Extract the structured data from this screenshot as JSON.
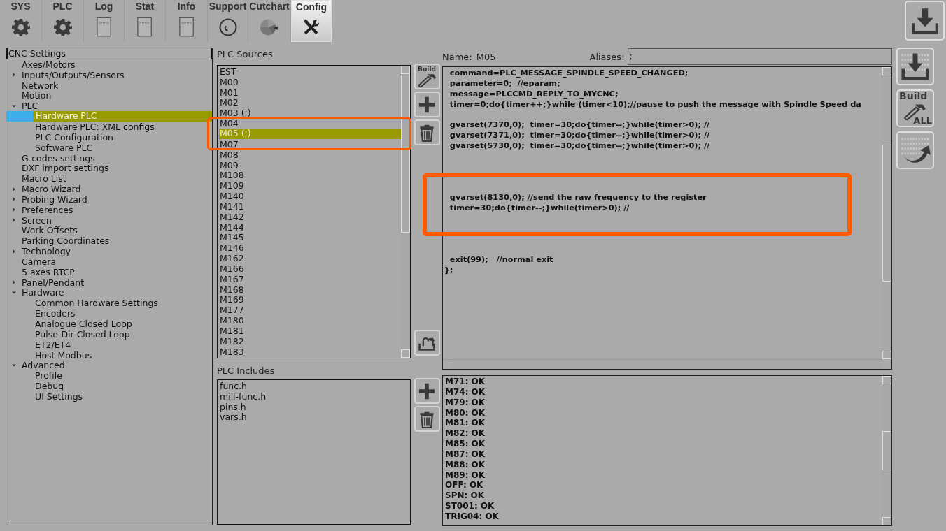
{
  "tabs": [
    {
      "label": "SYS",
      "kind": "settings",
      "selected": false
    },
    {
      "label": "PLC",
      "kind": "settings",
      "selected": false
    },
    {
      "label": "Log",
      "kind": "document",
      "selected": false
    },
    {
      "label": "Stat",
      "kind": "document",
      "selected": false
    },
    {
      "label": "Info",
      "kind": "document",
      "selected": false
    },
    {
      "label": "Support",
      "kind": "support",
      "selected": false
    },
    {
      "label": "Cutchart",
      "kind": "chart",
      "selected": false
    },
    {
      "label": "Config",
      "kind": "tools",
      "selected": true
    }
  ],
  "settings_tree": {
    "title": "CNC Settings",
    "items": [
      {
        "label": "Axes/Motors",
        "selected": false
      },
      {
        "label": "Inputs/Outputs/Sensors",
        "expanded": false,
        "selected": false
      },
      {
        "label": "Network",
        "selected": false
      },
      {
        "label": "Motion",
        "selected": false
      },
      {
        "label": "PLC",
        "expanded": true,
        "selected": false,
        "children": [
          {
            "label": "Hardware PLC",
            "selected": true
          },
          {
            "label": "Hardware PLC: XML configs",
            "selected": false
          },
          {
            "label": "PLC Configuration",
            "selected": false
          },
          {
            "label": "Software PLC",
            "selected": false
          }
        ]
      },
      {
        "label": "G-codes settings",
        "selected": false
      },
      {
        "label": "DXF import settings",
        "selected": false
      },
      {
        "label": "Macro List",
        "selected": false
      },
      {
        "label": "Macro Wizard",
        "expanded": false,
        "selected": false
      },
      {
        "label": "Probing Wizard",
        "expanded": false,
        "selected": false
      },
      {
        "label": "Preferences",
        "expanded": false,
        "selected": false
      },
      {
        "label": "Screen",
        "expanded": false,
        "selected": false
      },
      {
        "label": "Work Offsets",
        "selected": false
      },
      {
        "label": "Parking Coordinates",
        "selected": false
      },
      {
        "label": "Technology",
        "expanded": false,
        "selected": false
      },
      {
        "label": "Camera",
        "selected": false
      },
      {
        "label": "5 axes RTCP",
        "selected": false
      },
      {
        "label": "Panel/Pendant",
        "expanded": false,
        "selected": false
      },
      {
        "label": "Hardware",
        "expanded": true,
        "selected": false,
        "children": [
          {
            "label": "Common Hardware Settings",
            "selected": false
          },
          {
            "label": "Encoders",
            "selected": false
          },
          {
            "label": "Analogue Closed Loop",
            "selected": false
          },
          {
            "label": "Pulse-Dir Closed Loop",
            "selected": false
          },
          {
            "label": "ET2/ET4",
            "selected": false
          },
          {
            "label": "Host Modbus",
            "selected": false
          }
        ]
      },
      {
        "label": "Advanced",
        "expanded": true,
        "selected": false,
        "children": [
          {
            "label": "Profile",
            "selected": false
          },
          {
            "label": "Debug",
            "selected": false
          },
          {
            "label": "UI Settings",
            "selected": false
          }
        ]
      }
    ]
  },
  "plc_sources": {
    "title": "PLC Sources",
    "annotation_frame": true,
    "items": [
      {
        "label": "EST",
        "selected": false
      },
      {
        "label": "M00",
        "selected": false
      },
      {
        "label": "M01",
        "selected": false
      },
      {
        "label": "M02",
        "selected": false
      },
      {
        "label": "M03 (;)",
        "selected": false
      },
      {
        "label": "M04",
        "selected": false
      },
      {
        "label": "M05 (;)",
        "selected": true
      },
      {
        "label": "M07",
        "selected": false
      },
      {
        "label": "M08",
        "selected": false
      },
      {
        "label": "M09",
        "selected": false
      },
      {
        "label": "M108",
        "selected": false
      },
      {
        "label": "M109",
        "selected": false
      },
      {
        "label": "M140",
        "selected": false
      },
      {
        "label": "M141",
        "selected": false
      },
      {
        "label": "M142",
        "selected": false
      },
      {
        "label": "M144",
        "selected": false
      },
      {
        "label": "M145",
        "selected": false
      },
      {
        "label": "M146",
        "selected": false
      },
      {
        "label": "M162",
        "selected": false
      },
      {
        "label": "M166",
        "selected": false
      },
      {
        "label": "M167",
        "selected": false
      },
      {
        "label": "M168",
        "selected": false
      },
      {
        "label": "M169",
        "selected": false
      },
      {
        "label": "M177",
        "selected": false
      },
      {
        "label": "M180",
        "selected": false
      },
      {
        "label": "M181",
        "selected": false
      },
      {
        "label": "M182",
        "selected": false
      },
      {
        "label": "M183",
        "selected": false
      }
    ],
    "build_label": "Build"
  },
  "plc_includes": {
    "title": "PLC Includes",
    "items": [
      "func.h",
      "mill-func.h",
      "pins.h",
      "vars.h"
    ]
  },
  "editor": {
    "name_label": "Name:",
    "name": "M05",
    "aliases_label": "Aliases:",
    "aliases": ";",
    "annotation_frame": true,
    "code": "  command=PLC_MESSAGE_SPINDLE_SPEED_CHANGED;\n  parameter=0;  //eparam;\n  message=PLCCMD_REPLY_TO_MYCNC;\n  timer=0;do{timer++;}while (timer<10);//pause to push the message with Spindle Speed da\n\n  gvarset(7370,0);  timer=30;do{timer--;}while(timer>0); //\n  gvarset(7371,0);  timer=30;do{timer--;}while(timer>0); //\n  gvarset(5730,0);  timer=30;do{timer--;}while(timer>0); //\n\n\n\n\n  gvarset(8130,0); //send the raw frequency to the register\n  timer=30;do{timer--;}while(timer>0); //\n\n\n\n\n  exit(99);   //normal exit\n};"
  },
  "build_output": [
    "M71: OK",
    "M74: OK",
    "M79: OK",
    "M80: OK",
    "M81: OK",
    "M82: OK",
    "M85: OK",
    "M87: OK",
    "M88: OK",
    "M89: OK",
    "OFF: OK",
    "SPN: OK",
    "ST001: OK",
    "TRIG04: OK"
  ],
  "side_buttons": [
    {
      "kind": "download"
    },
    {
      "kind": "binary-download"
    },
    {
      "kind": "build-all",
      "label_top": "Build",
      "label_bottom": "ALL"
    },
    {
      "kind": "binary-upload"
    }
  ]
}
